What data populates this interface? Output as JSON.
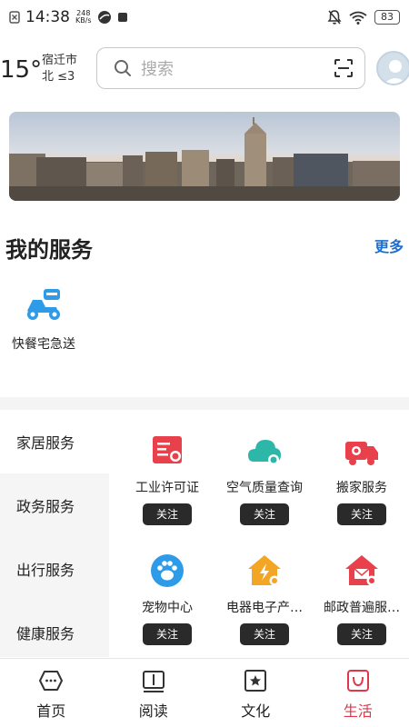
{
  "status_bar": {
    "time": "14:38",
    "net_speed_value": "248",
    "net_speed_unit": "KB/s",
    "battery": "83"
  },
  "header": {
    "temperature": "15°",
    "city": "宿迁市",
    "wind": "北 ≤3",
    "search_placeholder": "搜索"
  },
  "my_services": {
    "title": "我的服务",
    "more_label": "更多",
    "items": [
      {
        "label": "快餐宅急送",
        "icon": "scooter-icon"
      }
    ]
  },
  "categories": [
    {
      "label": "家居服务"
    },
    {
      "label": "政务服务"
    },
    {
      "label": "出行服务"
    },
    {
      "label": "健康服务"
    }
  ],
  "service_grid": {
    "follow_label": "关注",
    "items": [
      {
        "name": "工业许可证",
        "icon": "license-icon",
        "color": "#e8414b"
      },
      {
        "name": "空气质量查询",
        "icon": "cloud-icon",
        "color": "#2cb7a8"
      },
      {
        "name": "搬家服务",
        "icon": "truck-icon",
        "color": "#e8414b"
      },
      {
        "name": "宠物中心",
        "icon": "paw-icon",
        "color": "#2d9be8"
      },
      {
        "name": "电器电子产…",
        "icon": "appliance-icon",
        "color": "#f3a524"
      },
      {
        "name": "邮政普遍服…",
        "icon": "mail-icon",
        "color": "#e8414b"
      }
    ]
  },
  "tabs": [
    {
      "label": "首页",
      "icon": "home-icon"
    },
    {
      "label": "阅读",
      "icon": "book-icon"
    },
    {
      "label": "文化",
      "icon": "culture-icon"
    },
    {
      "label": "生活",
      "icon": "life-icon",
      "active": true
    }
  ],
  "colors": {
    "accent_red": "#e0384a",
    "link_blue": "#1c6fd0",
    "teal": "#2cb7a8",
    "orange": "#f3a524"
  }
}
